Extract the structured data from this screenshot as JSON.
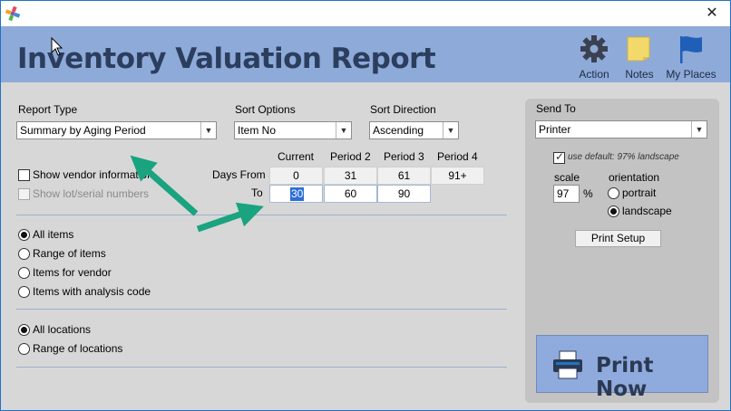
{
  "window": {
    "close_glyph": "✕"
  },
  "header": {
    "title": "Inventory Valuation Report",
    "action_label": "Action",
    "notes_label": "Notes",
    "places_label": "My Places"
  },
  "report_type": {
    "label": "Report Type",
    "value": "Summary by Aging Period"
  },
  "sort_options": {
    "label": "Sort Options",
    "value": "Item No"
  },
  "sort_direction": {
    "label": "Sort Direction",
    "value": "Ascending"
  },
  "options": {
    "show_vendor": "Show vendor information",
    "show_lot": "Show lot/serial numbers"
  },
  "aging": {
    "headers": [
      "Current",
      "Period 2",
      "Period 3",
      "Period 4"
    ],
    "days_from_label": "Days From",
    "to_label": "To",
    "days_from": [
      "0",
      "31",
      "61",
      "91+"
    ],
    "to": [
      "30",
      "60",
      "90"
    ]
  },
  "item_scope": {
    "options": [
      "All items",
      "Range of items",
      "Items for vendor",
      "Items with analysis code"
    ],
    "selected": "All items"
  },
  "location_scope": {
    "options": [
      "All locations",
      "Range of locations"
    ],
    "selected": "All locations"
  },
  "send_to": {
    "label": "Send To",
    "value": "Printer",
    "use_default": "use default: 97% landscape",
    "scale_label": "scale",
    "scale_value": "97",
    "percent": "%",
    "orientation_label": "orientation",
    "portrait": "portrait",
    "landscape": "landscape",
    "print_setup": "Print Setup",
    "print_now": "Print Now"
  },
  "colors": {
    "header_bg": "#8eaad8",
    "title": "#2b3e5e",
    "arrow": "#1aa37f",
    "print_now_bg": "#8faadd"
  },
  "icons": [
    "app-logo-icon",
    "gear-icon",
    "sticky-note-icon",
    "flag-icon",
    "printer-icon",
    "mouse-cursor-icon"
  ]
}
